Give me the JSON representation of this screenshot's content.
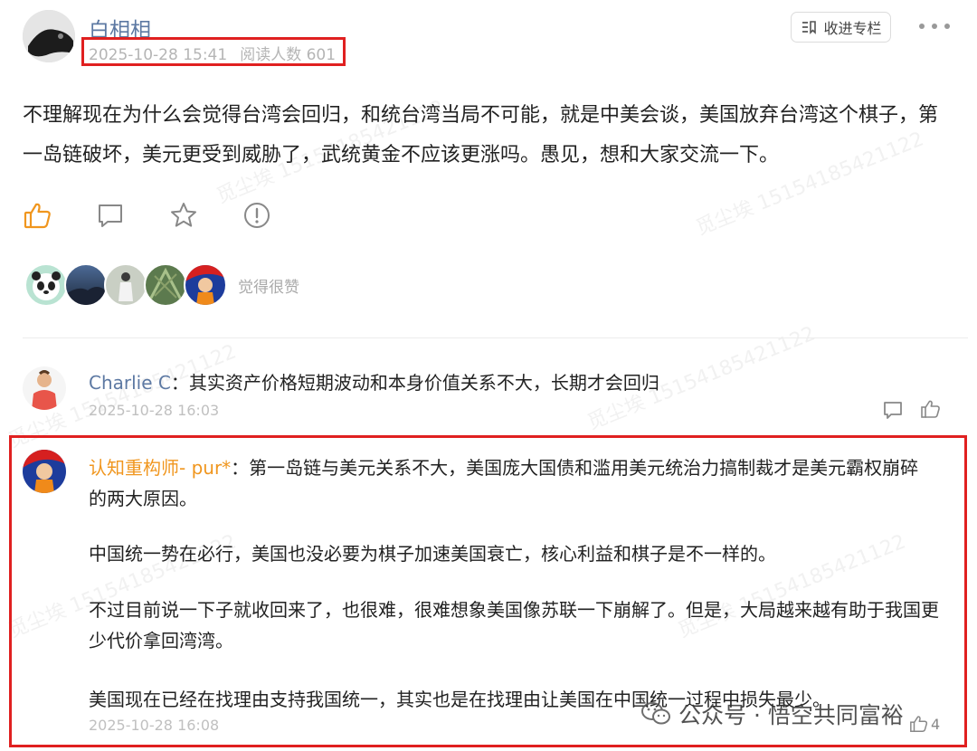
{
  "post": {
    "author": "白相相",
    "date": "2025-10-28 15:41",
    "reads": "阅读人数 601",
    "collect_label": "收进专栏",
    "body": "不理解现在为什么会觉得台湾会回归，和统台湾当局不可能，就是中美会谈，美国放弃台湾这个棋子，第一岛链破坏，美元更受到威胁了，武统黄金不应该更涨吗。愚见，想和大家交流一下。",
    "actions": [
      "thumbs-up-icon",
      "comment-icon",
      "star-icon",
      "report-icon"
    ],
    "likers_label": "觉得很赞",
    "likers": [
      "panda-avatar",
      "landscape-avatar",
      "person-avatar",
      "plant-avatar",
      "cartoon-avatar"
    ]
  },
  "comments": [
    {
      "name": "Charlie C",
      "text": "：其实资产价格短期波动和本身价值关系不大，长期才会回归",
      "date": "2025-10-28 16:03"
    },
    {
      "name": "认知重构师- pur*",
      "text": "：第一岛链与美元关系不大，美国庞大国债和滥用美元统治力搞制裁才是美元霸权崩碎的两大原因。",
      "paragraphs": [
        "中国统一势在必行，美国也没必要为棋子加速美国衰亡，核心利益和棋子是不一样的。",
        "不过目前说一下子就收回来了，也很难，很难想象美国像苏联一下崩解了。但是，大局越来越有助于我国更少代价拿回湾湾。",
        "美国现在已经在找理由支持我国统一，其实也是在找理由让美国在中国统一过程中损失最少。"
      ],
      "date": "2025-10-28 16:08",
      "like_count": "4"
    }
  ],
  "watermark": "觅尘埃 15154185421122",
  "brand": "公众号 · 悟空共同富裕",
  "colors": {
    "highlight": "#e02020",
    "link": "#5d79a3",
    "accent": "#f0961e"
  }
}
